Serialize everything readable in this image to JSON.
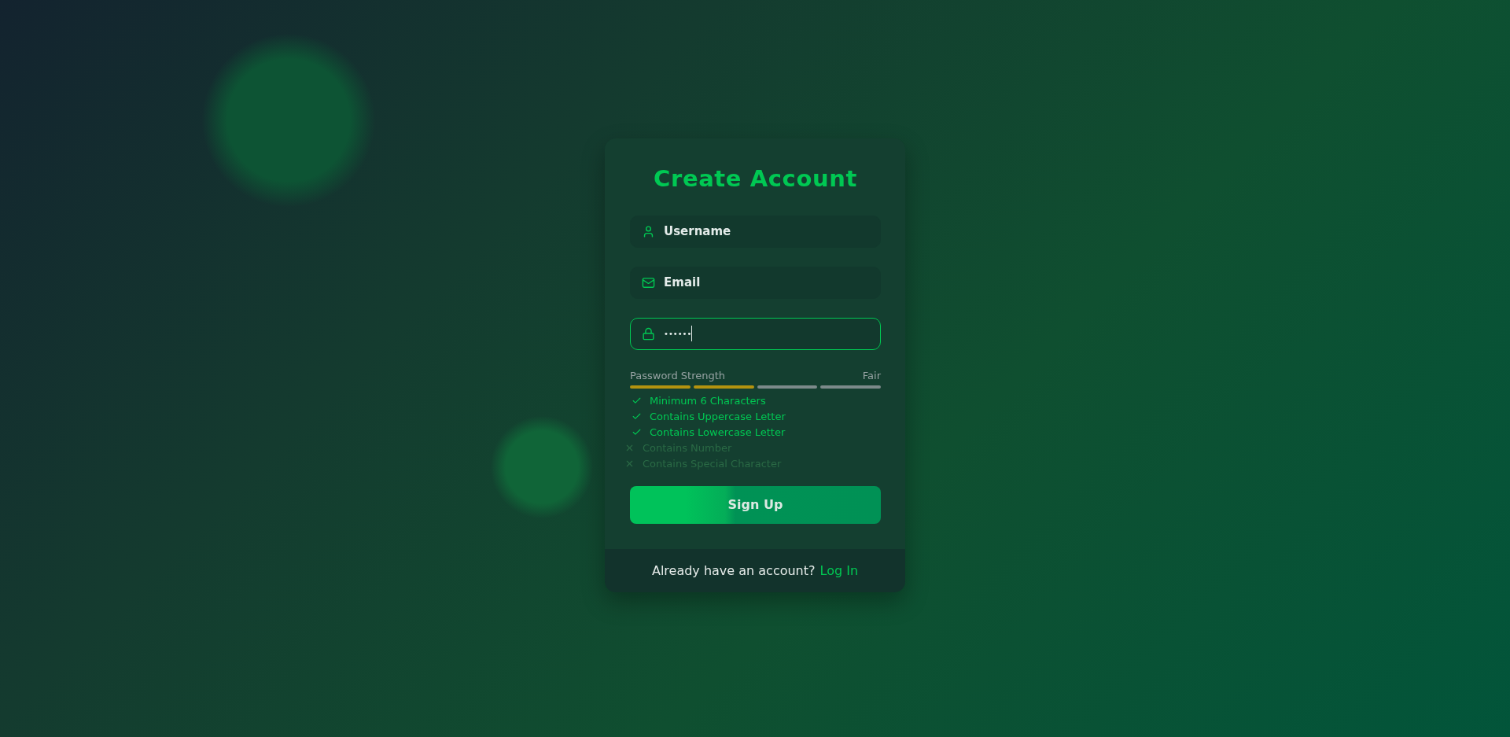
{
  "title": "Create Account",
  "fields": [
    {
      "kind": "username",
      "placeholder": "Username",
      "focused": false
    },
    {
      "kind": "email",
      "placeholder": "Email",
      "focused": false
    },
    {
      "kind": "password",
      "value": "••••••",
      "focused": true
    }
  ],
  "password_strength": {
    "label": "Password Strength",
    "rating": "Fair",
    "segments": [
      {
        "filled": true
      },
      {
        "filled": true
      },
      {
        "filled": false
      },
      {
        "filled": false
      }
    ]
  },
  "requirements": [
    {
      "label": "Minimum 6 Characters",
      "met": true
    },
    {
      "label": "Contains Uppercase Letter",
      "met": true
    },
    {
      "label": "Contains Lowercase Letter",
      "met": true
    },
    {
      "label": "Contains Number",
      "met": false
    },
    {
      "label": "Contains Special Character",
      "met": false
    }
  ],
  "submit_button": "Sign Up",
  "footer": {
    "text": "Already have an account?",
    "link": "Log In"
  }
}
